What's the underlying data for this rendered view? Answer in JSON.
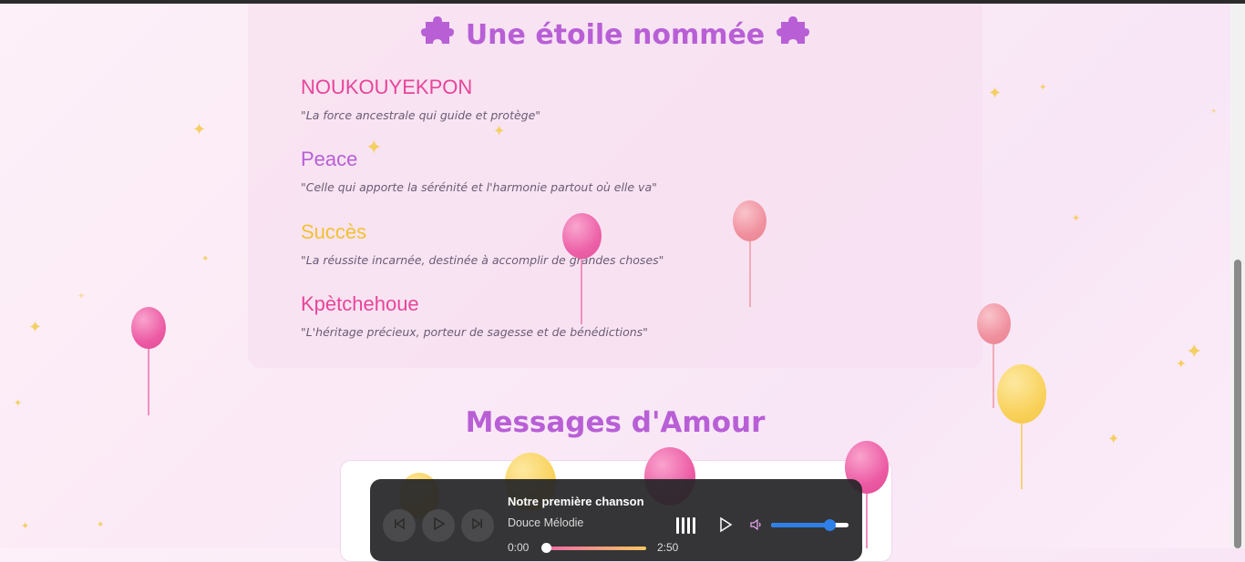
{
  "names_section": {
    "title": "Une étoile nommée",
    "names": [
      {
        "name": "NOUKOUYEKPON",
        "quote": "\"La force ancestrale qui guide et protège\"",
        "color": "#e8449a"
      },
      {
        "name": "Peace",
        "quote": "\"Celle qui apporte la sérénité et l'harmonie partout où elle va\"",
        "color": "#b85fd6"
      },
      {
        "name": "Succès",
        "quote": "\"La réussite incarnée, destinée à accomplir de grandes choses\"",
        "color": "#f1c232"
      },
      {
        "name": "Kpètchehoue",
        "quote": "\"L'héritage précieux, porteur de sagesse et de bénédictions\"",
        "color": "#e8449a"
      }
    ],
    "title_icon": "puzzle-piece-icon"
  },
  "messages_section": {
    "title": "Messages d'Amour"
  },
  "music_player": {
    "song_title": "Notre première chanson",
    "song_artist": "Douce Mélodie",
    "current_time": "0:00",
    "duration": "2:50",
    "progress": 0.0,
    "volume": 0.75,
    "accent_color": "#2f7fe8",
    "icons": [
      "skip-back-icon",
      "play-icon",
      "skip-forward-icon",
      "equalizer-icon",
      "play-icon",
      "volume-icon"
    ]
  },
  "colors": {
    "title": "#b85fd6",
    "balloon_pink": "#ef5fa7",
    "balloon_rose": "#f29aa8",
    "balloon_yellow": "#f9d25c"
  }
}
